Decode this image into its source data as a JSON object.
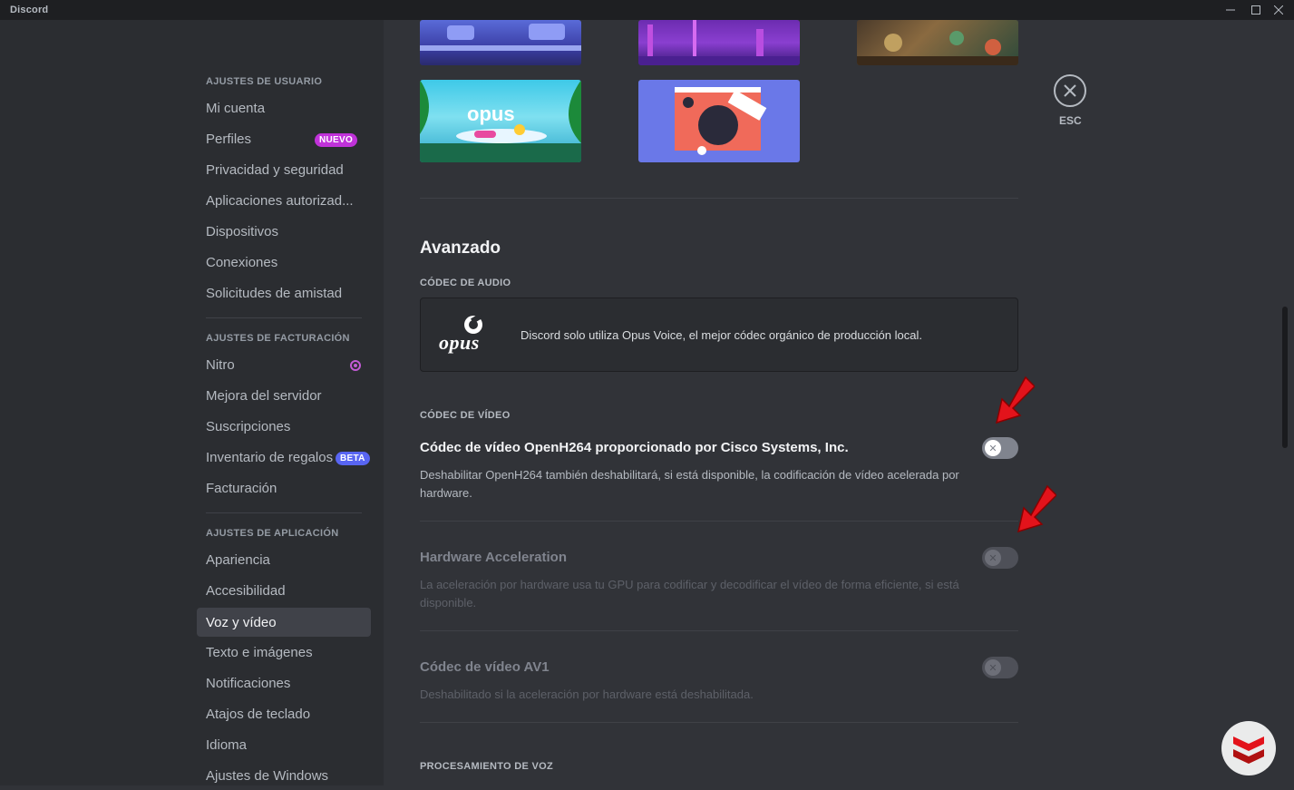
{
  "window": {
    "title": "Discord"
  },
  "sidebar": {
    "sections": [
      {
        "header": "AJUSTES DE USUARIO",
        "items": [
          "Mi cuenta",
          "Perfiles",
          "Privacidad y seguridad",
          "Aplicaciones autorizad...",
          "Dispositivos",
          "Conexiones",
          "Solicitudes de amistad"
        ]
      },
      {
        "header": "AJUSTES DE FACTURACIÓN",
        "items": [
          "Nitro",
          "Mejora del servidor",
          "Suscripciones",
          "Inventario de regalos",
          "Facturación"
        ]
      },
      {
        "header": "AJUSTES DE APLICACIÓN",
        "items": [
          "Apariencia",
          "Accesibilidad",
          "Voz y vídeo",
          "Texto e imágenes",
          "Notificaciones",
          "Atajos de teclado",
          "Idioma",
          "Ajustes de Windows"
        ]
      }
    ],
    "badges": {
      "perfiles": "NUEVO",
      "inventario": "BETA"
    },
    "active_item": "Voz y vídeo"
  },
  "main": {
    "advanced_title": "Avanzado",
    "audio_codec_header": "CÓDEC DE AUDIO",
    "opus_logo": "opus",
    "audio_codec_desc": "Discord solo utiliza Opus Voice, el mejor códec orgánico de producción local.",
    "video_codec_header": "CÓDEC DE VÍDEO",
    "settings": [
      {
        "title": "Códec de vídeo OpenH264 proporcionado por Cisco Systems, Inc.",
        "desc": "Deshabilitar OpenH264 también deshabilitará, si está disponible, la codificación de vídeo acelerada por hardware.",
        "enabled": false,
        "disabled": false
      },
      {
        "title": "Hardware Acceleration",
        "desc": "La aceleración por hardware usa tu GPU para codificar y decodificar el vídeo de forma eficiente, si está disponible.",
        "enabled": false,
        "disabled": true
      },
      {
        "title": "Códec de vídeo AV1",
        "desc": "Deshabilitado si la aceleración por hardware está deshabilitada.",
        "enabled": false,
        "disabled": true
      }
    ],
    "voice_processing_header": "PROCESAMIENTO DE VOZ",
    "esc_label": "ESC"
  },
  "colors": {
    "accent": "#5865f2",
    "nuevo_badge": "#c032d9",
    "beta_badge": "#5865f2",
    "nitro": "#c25bd4",
    "arrow": "#e3131b"
  },
  "icons": {
    "close": "x-icon",
    "toggle_off": "x-icon",
    "nitro": "nitro-icon"
  }
}
